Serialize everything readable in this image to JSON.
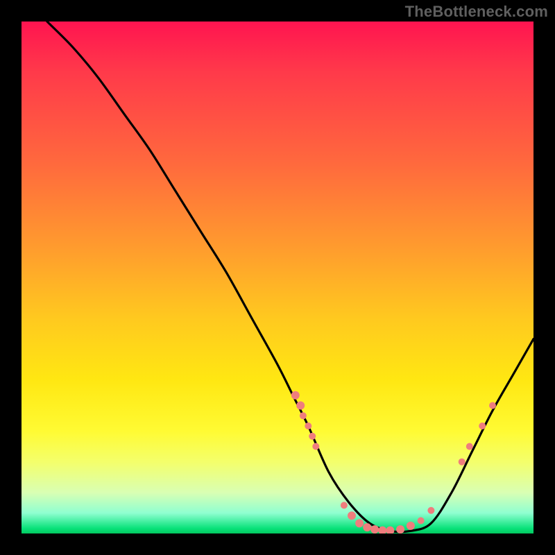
{
  "attribution": "TheBottleneck.com",
  "colors": {
    "background": "#000000",
    "curve": "#000000",
    "markers": "#ef7d7d",
    "attribution_text": "#5f5f5f"
  },
  "chart_data": {
    "type": "line",
    "title": "",
    "xlabel": "",
    "ylabel": "",
    "xlim": [
      0,
      100
    ],
    "ylim": [
      0,
      100
    ],
    "curve": {
      "x": [
        5,
        10,
        15,
        20,
        25,
        30,
        35,
        40,
        45,
        50,
        53,
        56,
        60,
        64,
        68,
        72,
        76,
        80,
        84,
        88,
        92,
        96,
        100
      ],
      "y": [
        100,
        95,
        89,
        82,
        75,
        67,
        59,
        51,
        42,
        33,
        27,
        21,
        12,
        6,
        2,
        0.5,
        0.5,
        2,
        8,
        16,
        24,
        31,
        38
      ]
    },
    "marker_clusters": [
      {
        "x_range": [
          53,
          57
        ],
        "y_range": [
          20,
          28
        ],
        "count": 6,
        "note": "left-descent cluster"
      },
      {
        "x_range": [
          63,
          76
        ],
        "y_range": [
          0,
          4
        ],
        "count": 12,
        "note": "valley-floor cluster"
      },
      {
        "x_range": [
          86,
          92
        ],
        "y_range": [
          14,
          25
        ],
        "count": 4,
        "note": "right-ascent cluster"
      }
    ],
    "markers": [
      {
        "x": 53.5,
        "y": 27,
        "r": 6
      },
      {
        "x": 54.5,
        "y": 25,
        "r": 6
      },
      {
        "x": 55.0,
        "y": 23,
        "r": 5
      },
      {
        "x": 56.0,
        "y": 21,
        "r": 5
      },
      {
        "x": 56.8,
        "y": 19,
        "r": 5
      },
      {
        "x": 57.5,
        "y": 17,
        "r": 5
      },
      {
        "x": 63.0,
        "y": 5.5,
        "r": 5
      },
      {
        "x": 64.5,
        "y": 3.5,
        "r": 6
      },
      {
        "x": 66.0,
        "y": 2.0,
        "r": 6
      },
      {
        "x": 67.5,
        "y": 1.2,
        "r": 6
      },
      {
        "x": 69.0,
        "y": 0.8,
        "r": 6
      },
      {
        "x": 70.5,
        "y": 0.6,
        "r": 6
      },
      {
        "x": 72.0,
        "y": 0.6,
        "r": 6
      },
      {
        "x": 74.0,
        "y": 0.8,
        "r": 6
      },
      {
        "x": 76.0,
        "y": 1.5,
        "r": 6
      },
      {
        "x": 78.0,
        "y": 2.5,
        "r": 5
      },
      {
        "x": 80.0,
        "y": 4.5,
        "r": 5
      },
      {
        "x": 86.0,
        "y": 14,
        "r": 5
      },
      {
        "x": 87.5,
        "y": 17,
        "r": 5
      },
      {
        "x": 90.0,
        "y": 21,
        "r": 5
      },
      {
        "x": 92.0,
        "y": 25,
        "r": 5
      }
    ],
    "gradient_stops_note": "Background is a vertical heat gradient from red (top, high bottleneck) through orange/yellow to green (bottom, optimal)."
  }
}
